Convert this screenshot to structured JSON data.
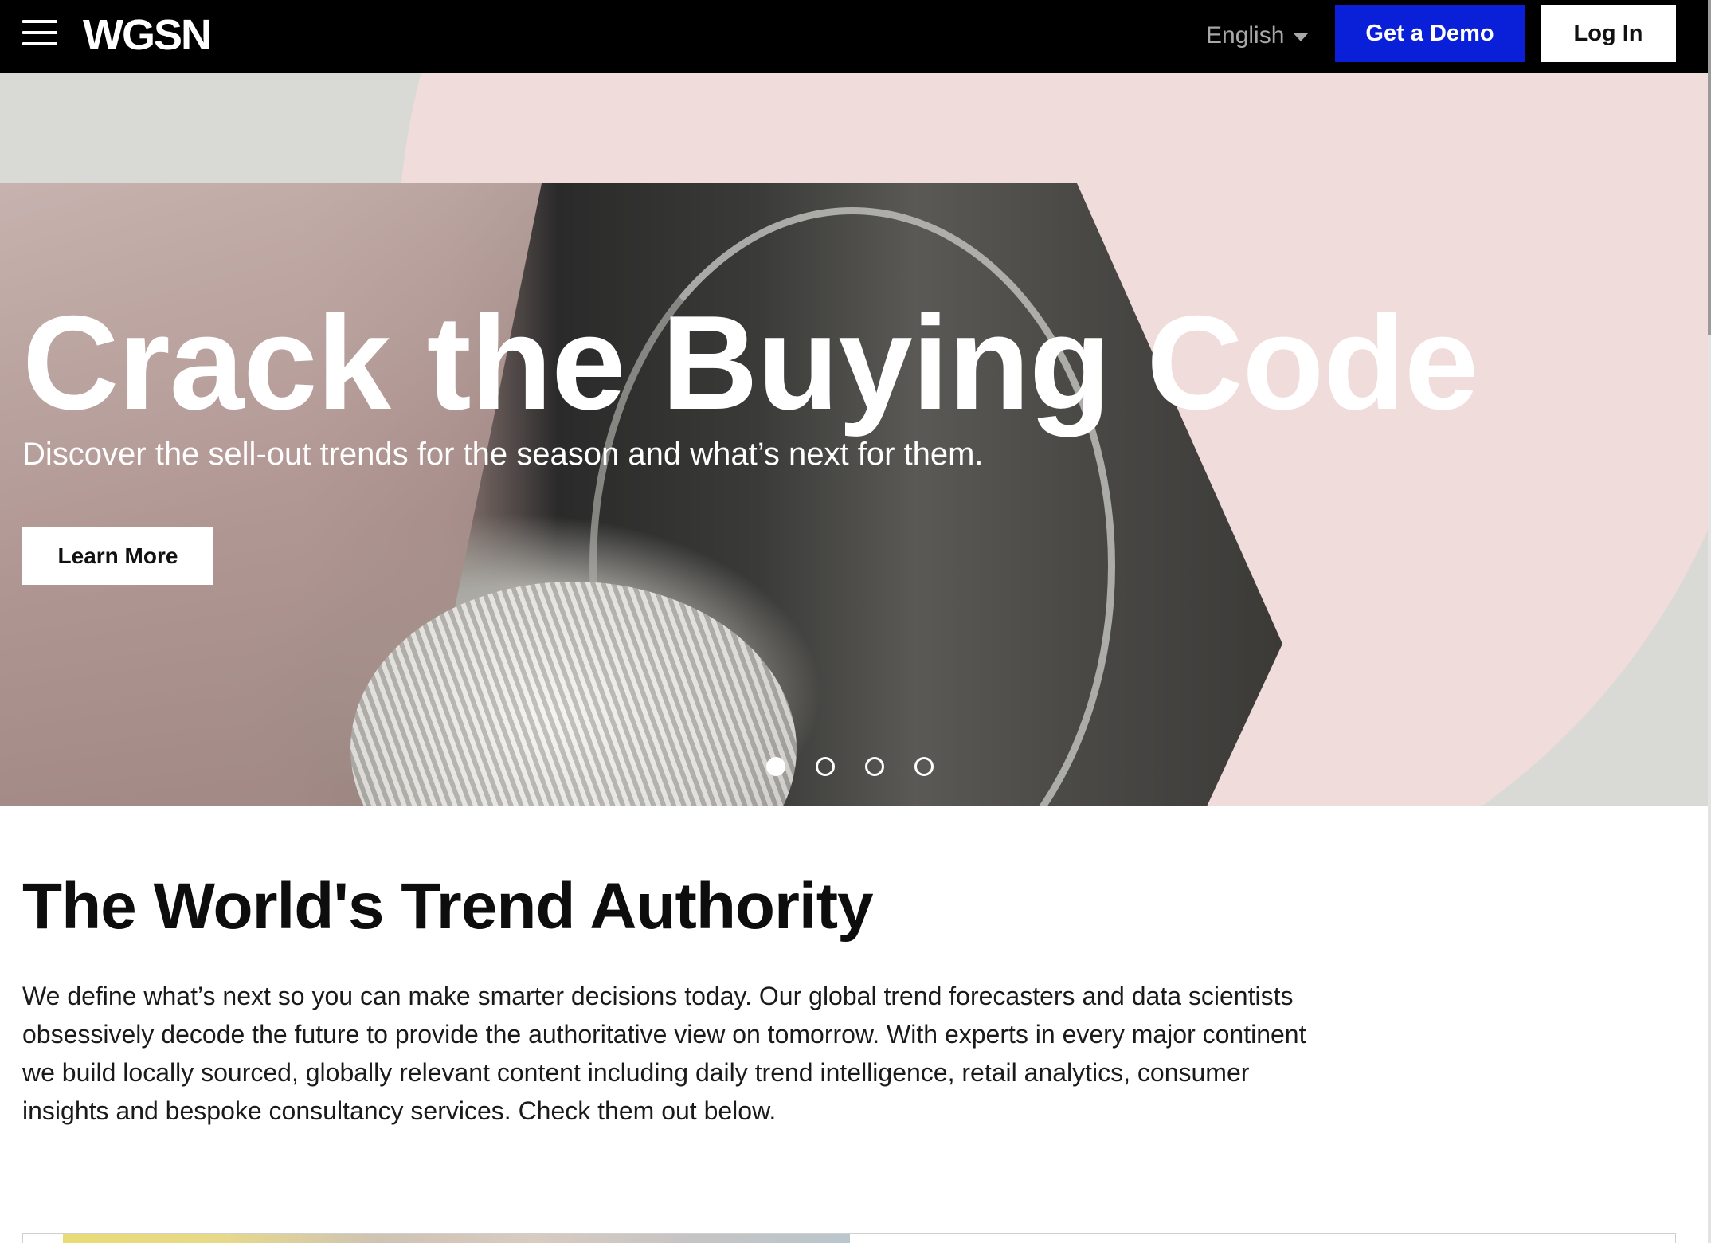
{
  "header": {
    "menu_icon": "hamburger-menu-icon",
    "logo_text": "WGSN",
    "language_label": "English",
    "language_icon": "chevron-down-icon",
    "demo_button": "Get a Demo",
    "login_button": "Log In"
  },
  "hero": {
    "title": "Crack the Buying Code",
    "subtitle": "Discover the sell-out trends for the season and what’s next for them.",
    "cta_label": "Learn More",
    "slides_total": 4,
    "active_slide": 1
  },
  "intro": {
    "heading": "The World's Trend Authority",
    "body": "We define what’s next so you can make smarter decisions today. Our global trend forecasters and data scientists obsessively decode the future to provide the authoritative view on tomorrow. With experts in every major continent we build locally sourced, globally relevant content including daily trend intelligence, retail analytics, consumer insights and bespoke consultancy services. Check them out below."
  },
  "colors": {
    "header_bg": "#000000",
    "accent_blue": "#0a1fd8",
    "hero_pink": "#f0dcdb",
    "hero_grey": "#d9dad6"
  }
}
